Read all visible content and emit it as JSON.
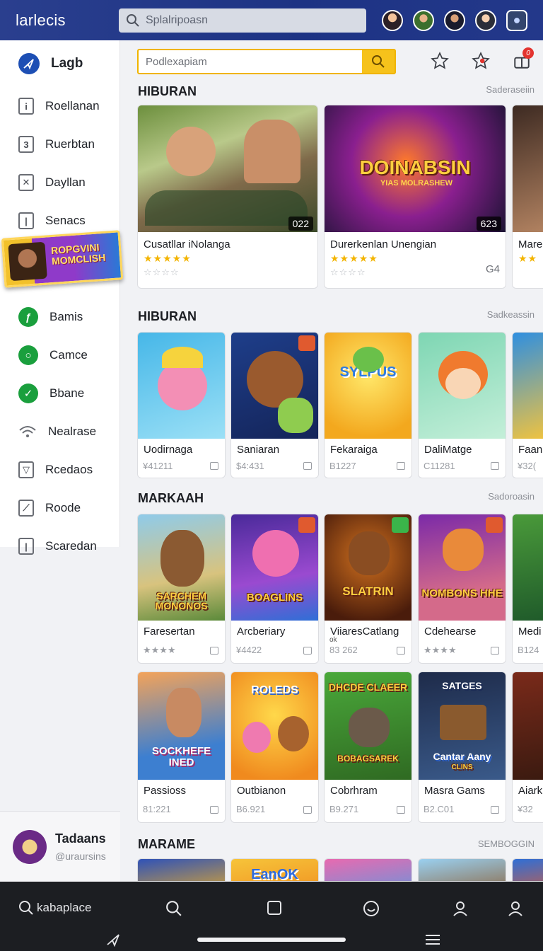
{
  "topbar": {
    "brand": "larlecis",
    "search_placeholder": "Splalripoasn"
  },
  "sidebar": {
    "header": "Lagb",
    "items": [
      {
        "label": "Roellanan",
        "icon": "info-box-icon"
      },
      {
        "label": "Ruerbtan",
        "icon": "number-box-icon"
      },
      {
        "label": "Dayllan",
        "icon": "wrench-icon"
      },
      {
        "label": "Senacs",
        "icon": "document-icon"
      },
      {
        "label": "Bamis",
        "icon": "green-badge-icon"
      },
      {
        "label": "Camce",
        "icon": "green-chat-icon"
      },
      {
        "label": "Bbane",
        "icon": "green-check-icon"
      },
      {
        "label": "Nealrase",
        "icon": "wifi-icon"
      },
      {
        "label": "Rcedaos",
        "icon": "image-icon"
      },
      {
        "label": "Roode",
        "icon": "chart-icon"
      },
      {
        "label": "Scaredan",
        "icon": "box-icon"
      }
    ],
    "promo_text": "ROPGVINI MOMCLISH"
  },
  "profile": {
    "name": "Tadaans",
    "handle": "@uraursins"
  },
  "main": {
    "search_placeholder": "Podlexapiam",
    "badge_count": "0",
    "sections": [
      {
        "title": "HIBURAN",
        "link": "Saderaseiin",
        "cards": [
          {
            "name": "Cusatllar iNolanga",
            "duration": "022",
            "extra": ""
          },
          {
            "name": "Durerkenlan Unengian",
            "duration": "623",
            "extra": "G4",
            "art_text": "DOINABSIN",
            "art_sub": "YIAS MOLRASHEW"
          },
          {
            "name": "Mare",
            "duration": "",
            "extra": ""
          }
        ]
      },
      {
        "title": "HIBURAN",
        "link": "Sadkeassin",
        "cards": [
          {
            "name": "Uodirnaga",
            "meta": "¥41211"
          },
          {
            "name": "Saniaran",
            "meta": "$4:431"
          },
          {
            "name": "Fekaraiga",
            "meta": "B1227",
            "art_text": "SYLPUS"
          },
          {
            "name": "DaliMatge",
            "meta": "C11281"
          },
          {
            "name": "Faan",
            "meta": "¥32("
          }
        ]
      },
      {
        "title": "MARKAAH",
        "link": "Sadoroasin",
        "cards": [
          {
            "name": "Faresertan",
            "meta": "★★★★",
            "art_text": "SARCHEM MONONOS"
          },
          {
            "name": "Arcberiary",
            "meta": "¥4422",
            "art_text": "BOAGLINS"
          },
          {
            "name": "ViiaresCatlang",
            "meta": "83 262",
            "art_text": "SLATRIN",
            "sub": "ok"
          },
          {
            "name": "Cdehearse",
            "meta": "★★★★",
            "art_text": "NOMBONS HHE"
          },
          {
            "name": "Medi",
            "meta": "B124"
          }
        ]
      },
      {
        "title": "",
        "link": "",
        "cards": [
          {
            "name": "Passioss",
            "meta": "81:221",
            "art_text": "SOCKHEFE INED"
          },
          {
            "name": "Outbianon",
            "meta": "B6.921",
            "art_text": "ROLEDS"
          },
          {
            "name": "Cobrhram",
            "meta": "B9.271",
            "art_text": "BOBAGSAREK",
            "art_top": "DHCDE CLAEER"
          },
          {
            "name": "Masra Gams",
            "meta": "B2.C01",
            "art_text": "Cantar Aany",
            "art_top": "SATGES",
            "art_sub": "CLINS"
          },
          {
            "name": "Aiark",
            "meta": "¥32"
          }
        ]
      },
      {
        "title": "MARAME",
        "link": "SEMBOGGIN",
        "cards": [
          {
            "name": "",
            "art_text": ""
          },
          {
            "name": "",
            "art_text": "EanOK"
          },
          {
            "name": "",
            "art_text": ""
          },
          {
            "name": "",
            "art_text": ""
          },
          {
            "name": "",
            "art_text": ""
          }
        ]
      }
    ]
  },
  "bottom_bar": {
    "search_label": "kabaplace",
    "icons": [
      "search-icon",
      "square-icon",
      "smile-icon",
      "person-icon",
      "profile-icon"
    ]
  }
}
